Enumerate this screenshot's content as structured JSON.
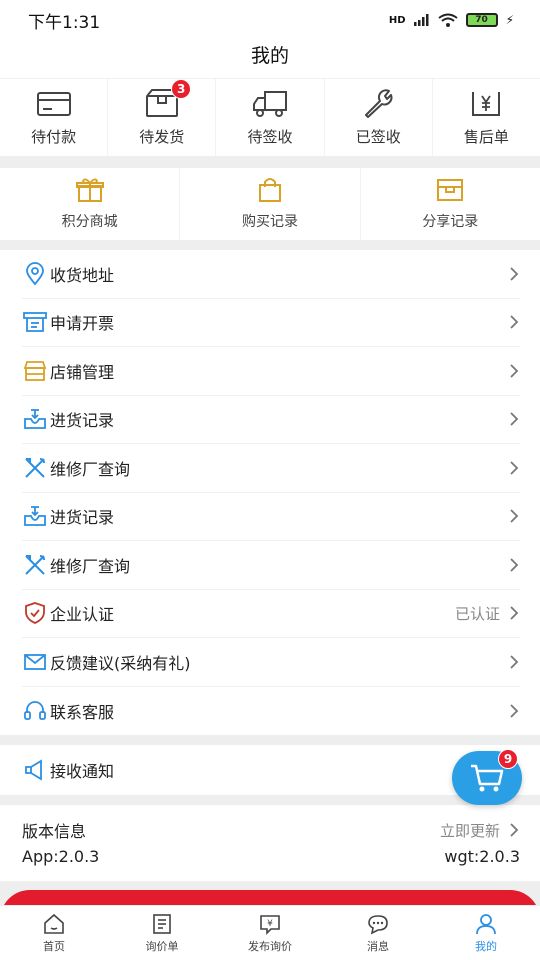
{
  "status_bar": {
    "time": "下午1:31",
    "network": "HD",
    "battery": "70"
  },
  "header": {
    "title": "我的"
  },
  "orders": [
    {
      "label": "待付款",
      "icon": "card-icon"
    },
    {
      "label": "待发货",
      "icon": "box-icon",
      "badge": "3"
    },
    {
      "label": "待签收",
      "icon": "truck-icon"
    },
    {
      "label": "已签收",
      "icon": "wrench-icon"
    },
    {
      "label": "售后单",
      "icon": "yen-icon"
    }
  ],
  "mall": [
    {
      "label": "积分商城",
      "icon": "gift-icon"
    },
    {
      "label": "购买记录",
      "icon": "bag-icon"
    },
    {
      "label": "分享记录",
      "icon": "share-box-icon"
    }
  ],
  "menu": [
    {
      "label": "收货地址",
      "icon": "location-icon"
    },
    {
      "label": "申请开票",
      "icon": "invoice-icon"
    },
    {
      "label": "店铺管理",
      "icon": "shop-icon"
    },
    {
      "label": "进货记录",
      "icon": "inbox-icon"
    },
    {
      "label": "维修厂查询",
      "icon": "tools-icon"
    },
    {
      "label": "进货记录",
      "icon": "inbox-icon"
    },
    {
      "label": "维修厂查询",
      "icon": "tools-icon"
    },
    {
      "label": "企业认证",
      "icon": "shield-check-icon",
      "value": "已认证"
    },
    {
      "label": "反馈建议(采纳有礼)",
      "icon": "mail-icon"
    },
    {
      "label": "联系客服",
      "icon": "headset-icon"
    }
  ],
  "notify": {
    "label": "接收通知"
  },
  "version": {
    "title": "版本信息",
    "update": "立即更新",
    "app": "App:2.0.3",
    "wgt": "wgt:2.0.3"
  },
  "cart": {
    "badge": "9"
  },
  "tabs": [
    {
      "label": "首页"
    },
    {
      "label": "询价单"
    },
    {
      "label": "发布询价"
    },
    {
      "label": "消息"
    },
    {
      "label": "我的"
    }
  ],
  "colors": {
    "accent": "#2b8fe3",
    "badge": "#e8202e",
    "icon_gold": "#d9a227",
    "icon_blue": "#2b8fe3",
    "icon_red": "#c0392b"
  }
}
